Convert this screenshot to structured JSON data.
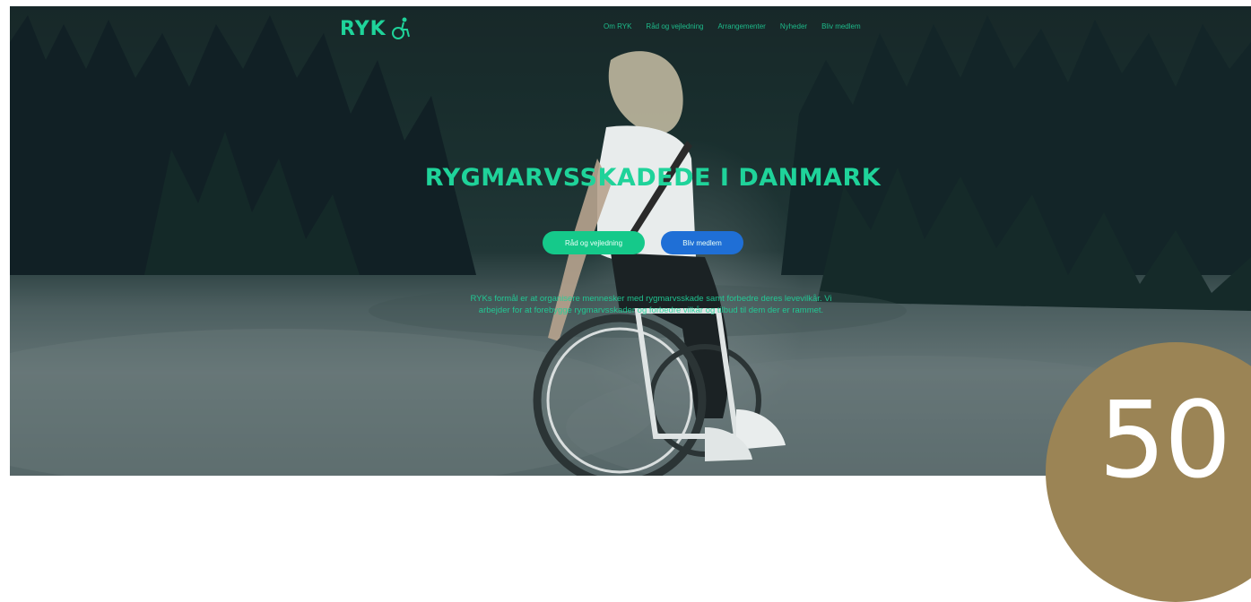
{
  "header": {
    "logo_text": "RYK",
    "logo_icon": "wheelchair-icon",
    "nav": [
      {
        "label": "Om RYK"
      },
      {
        "label": "Råd og vejledning"
      },
      {
        "label": "Arrangementer"
      },
      {
        "label": "Nyheder"
      },
      {
        "label": "Bliv medlem"
      }
    ]
  },
  "hero": {
    "title": "RYGMARVSSKADEDE I DANMARK",
    "primary_button": "Råd og vejledning",
    "secondary_button": "Bliv medlem",
    "description": "RYKs formål er at organisere mennesker med rygmarvsskade samt forbedre deres levevilkår. Vi arbejder for at forebygge rygmarvsskader og forbedre vilkår og tilbud til dem der er rammet."
  },
  "badge": {
    "text": "50"
  },
  "colors": {
    "accent": "#1fd39a",
    "primary_button": "#15c98a",
    "secondary_button": "#1f6fd6",
    "badge": "#9b8455"
  }
}
